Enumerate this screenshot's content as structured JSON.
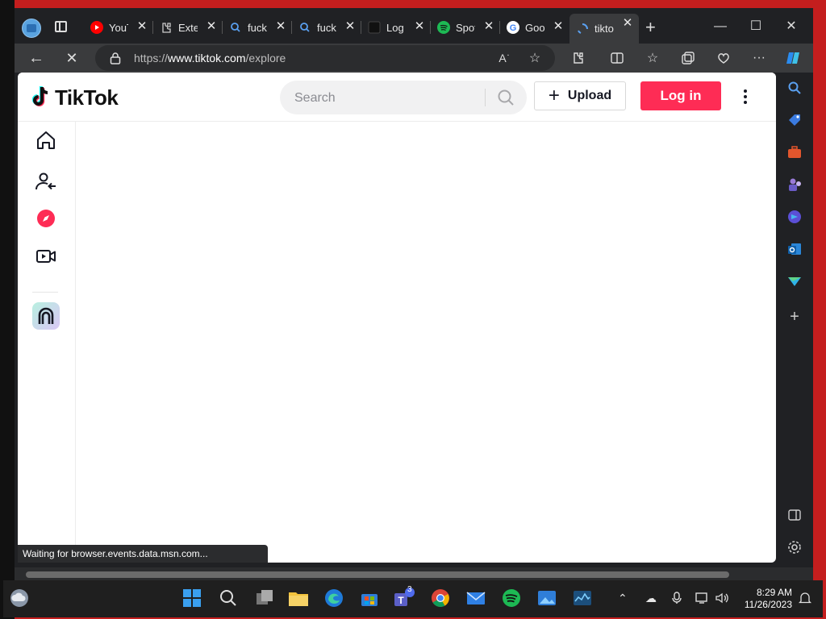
{
  "browser": {
    "tabs": [
      {
        "title": "YouTube",
        "favicon": "youtube-icon"
      },
      {
        "title": "Extensions",
        "favicon": "extensions-icon"
      },
      {
        "title": "fuck",
        "favicon": "search-icon"
      },
      {
        "title": "fuck",
        "favicon": "search-icon"
      },
      {
        "title": "Log",
        "favicon": "dark-app-icon"
      },
      {
        "title": "Spotify",
        "favicon": "spotify-icon"
      },
      {
        "title": "Google",
        "favicon": "google-icon"
      },
      {
        "title": "tiktok",
        "favicon": "loading-spinner-icon",
        "active": true
      }
    ],
    "url": {
      "prefix": "https://",
      "domain": "www.tiktok.com",
      "path": "/explore"
    },
    "status_text": "Waiting for browser.events.data.msn.com..."
  },
  "tiktok": {
    "logo_text": "TikTok",
    "search_placeholder": "Search",
    "upload_label": "Upload",
    "login_label": "Log in",
    "brand_color": "#fe2c55",
    "nav": [
      "home-icon",
      "following-icon",
      "explore-icon",
      "live-icon",
      "creator-avatar"
    ]
  },
  "taskbar": {
    "time": "8:29 AM",
    "date": "11/26/2023",
    "teams_badge": "3"
  }
}
